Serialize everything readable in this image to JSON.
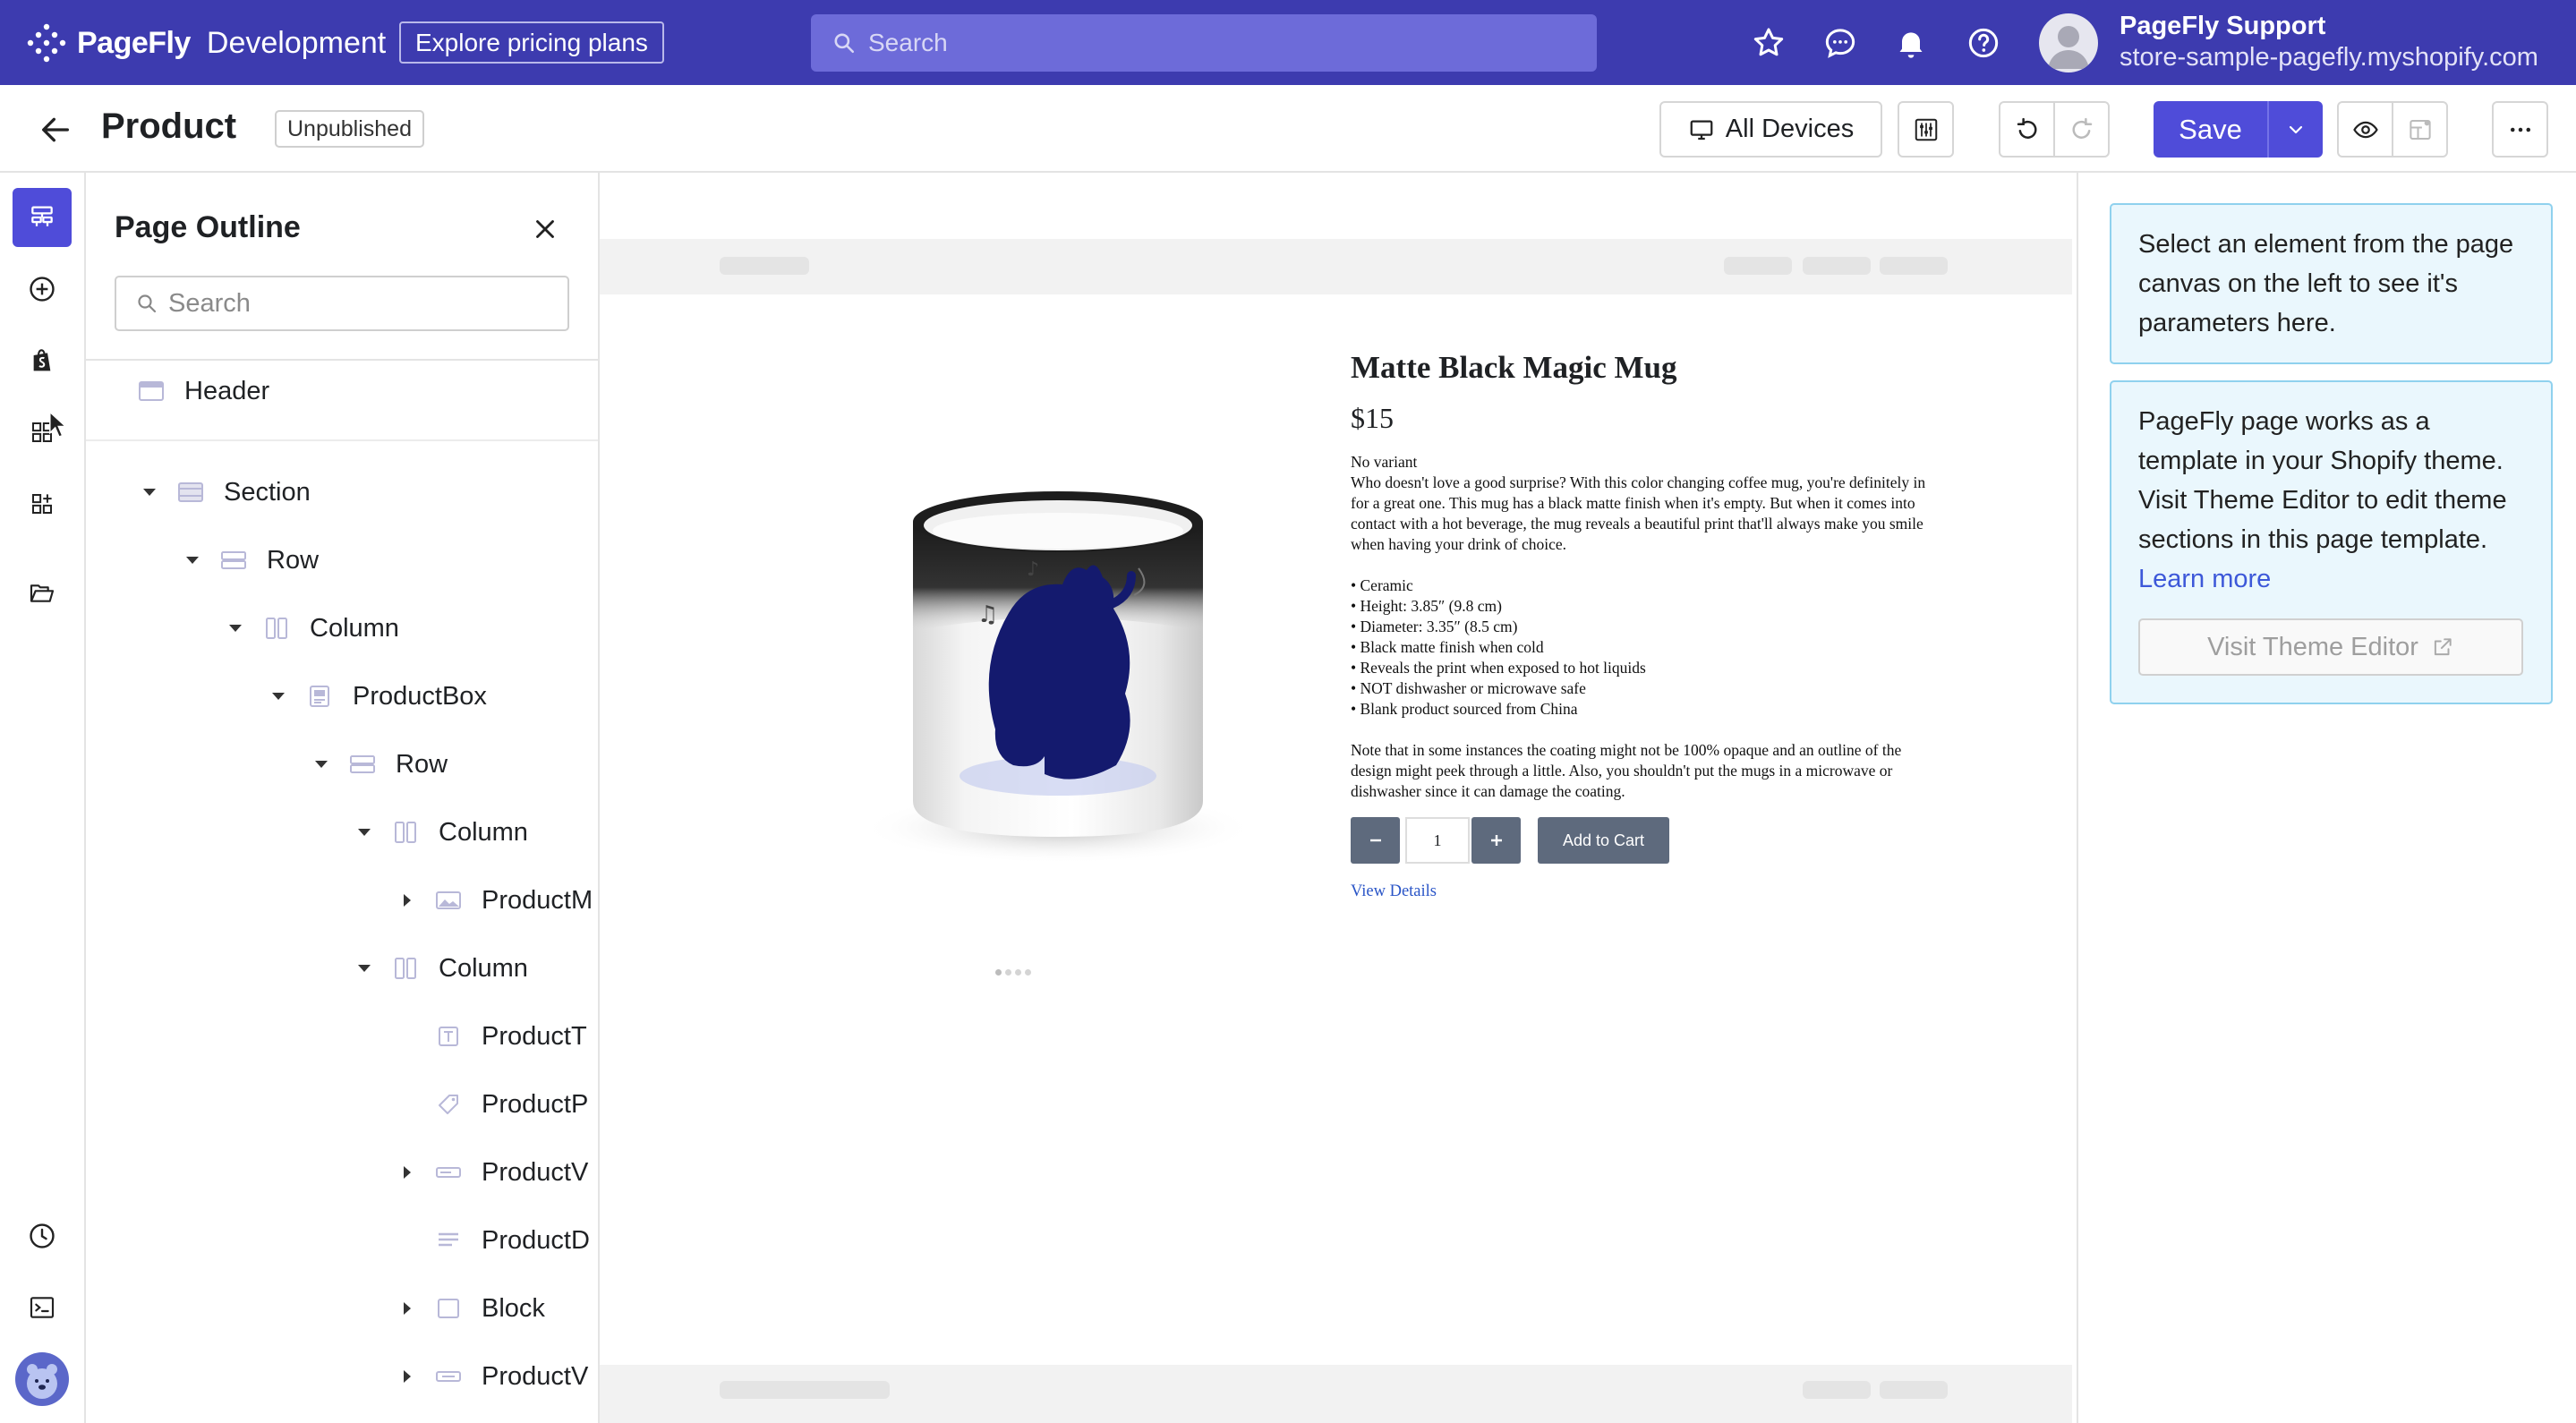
{
  "topbar": {
    "brand_name": "PageFly",
    "brand_env": "Development",
    "explore_label": "Explore pricing plans",
    "search_placeholder": "Search",
    "user_name": "PageFly Support",
    "user_store": "store-sample-pagefly.myshopify.com",
    "icons": [
      "star-icon",
      "chat-icon",
      "bell-icon",
      "help-icon"
    ],
    "bg_color": "#3d3baf"
  },
  "toolbar": {
    "page_title": "Product",
    "status": "Unpublished",
    "devices_label": "All Devices",
    "save_label": "Save",
    "accent_color": "#4f4cd9"
  },
  "rail": {
    "items": [
      "page-outline-icon",
      "add-element-icon",
      "shopify-icon",
      "grid-icon",
      "apps-icon",
      "folder-icon",
      "history-icon",
      "terminal-icon",
      "avatar"
    ]
  },
  "outline": {
    "title": "Page Outline",
    "search_placeholder": "Search",
    "tree": [
      {
        "label": "Header"
      },
      {
        "label": "Section"
      },
      {
        "label": "Row"
      },
      {
        "label": "Column"
      },
      {
        "label": "ProductBox"
      },
      {
        "label": "Row"
      },
      {
        "label": "Column"
      },
      {
        "label": "ProductM"
      },
      {
        "label": "Column"
      },
      {
        "label": "ProductT"
      },
      {
        "label": "ProductP"
      },
      {
        "label": "ProductV"
      },
      {
        "label": "ProductD"
      },
      {
        "label": "Block"
      },
      {
        "label": "ProductV"
      }
    ]
  },
  "product": {
    "title": "Matte Black Magic Mug",
    "price": "$15",
    "variant": "No variant",
    "description": "Who doesn't love a good surprise? With this color changing coffee mug, you're definitely in for a great one. This mug has a black matte finish when it's empty. But when it comes into contact with a hot beverage, the mug reveals a beautiful print that'll always make you smile when having your drink of choice.",
    "bullets": [
      "• Ceramic",
      "• Height: 3.85″ (9.8 cm)",
      "• Diameter: 3.35″ (8.5 cm)",
      "• Black matte finish when cold",
      "• Reveals the print when exposed to hot liquids",
      "• NOT dishwasher or microwave safe",
      "• Blank product sourced from China"
    ],
    "note": "Note that in some instances the coating might not be 100% opaque and an outline of the design might peek through a little. Also, you shouldn't put the mugs in a microwave or dishwasher since it can damage the coating.",
    "quantity": "1",
    "add_to_cart": "Add to Cart",
    "view_details": "View Details"
  },
  "rpanel": {
    "hint": "Select an element from the page canvas on the left to see it's parameters here.",
    "theme_info": "PageFly page works as a template in your Shopify theme. Visit Theme Editor to edit theme sections in this page template.",
    "learn_more": "Learn more",
    "visit_label": "Visit Theme Editor"
  }
}
